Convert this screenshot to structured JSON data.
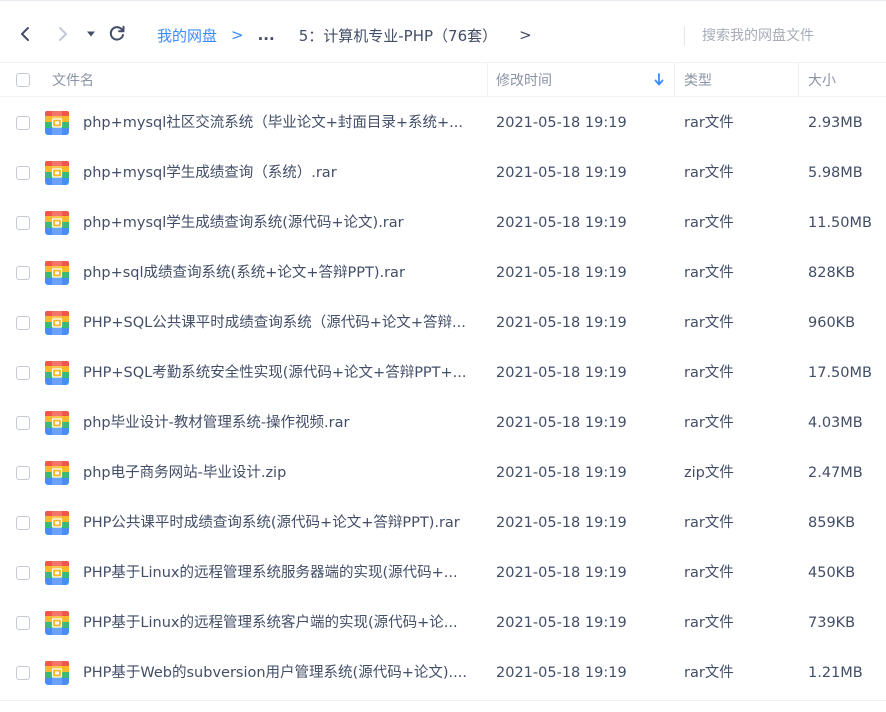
{
  "toolbar": {
    "breadcrumb_root": "我的网盘",
    "breadcrumb_sep": ">",
    "breadcrumb_ellipsis": "...",
    "breadcrumb_current": "5：计算机专业-PHP（76套）",
    "breadcrumb_next": ">",
    "search_placeholder": "搜索我的网盘文件"
  },
  "icons": {
    "back": "chevron-left-icon",
    "forward": "chevron-right-icon",
    "dropdown": "caret-down-icon",
    "refresh": "refresh-icon",
    "sort": "arrow-down-icon",
    "file": "archive-file-icon"
  },
  "colors": {
    "accent": "#3b8cff",
    "text": "#424e67",
    "muted": "#8a93a6"
  },
  "table": {
    "headers": {
      "name": "文件名",
      "modified": "修改时间",
      "type": "类型",
      "size": "大小"
    },
    "sort_column": "modified",
    "sort_direction": "desc",
    "rows": [
      {
        "name": "php+mysql社区交流系统（毕业论文+封面目录+系统+...",
        "modified": "2021-05-18 19:19",
        "type": "rar文件",
        "size": "2.93MB"
      },
      {
        "name": "php+mysql学生成绩查询（系统）.rar",
        "modified": "2021-05-18 19:19",
        "type": "rar文件",
        "size": "5.98MB"
      },
      {
        "name": "php+mysql学生成绩查询系统(源代码+论文).rar",
        "modified": "2021-05-18 19:19",
        "type": "rar文件",
        "size": "11.50MB"
      },
      {
        "name": "php+sql成绩查询系统(系统+论文+答辩PPT).rar",
        "modified": "2021-05-18 19:19",
        "type": "rar文件",
        "size": "828KB"
      },
      {
        "name": "PHP+SQL公共课平时成绩查询系统（源代码+论文+答辩...",
        "modified": "2021-05-18 19:19",
        "type": "rar文件",
        "size": "960KB"
      },
      {
        "name": "PHP+SQL考勤系统安全性实现(源代码+论文+答辩PPT+...",
        "modified": "2021-05-18 19:19",
        "type": "rar文件",
        "size": "17.50MB"
      },
      {
        "name": "php毕业设计-教材管理系统-操作视频.rar",
        "modified": "2021-05-18 19:19",
        "type": "rar文件",
        "size": "4.03MB"
      },
      {
        "name": "php电子商务网站-毕业设计.zip",
        "modified": "2021-05-18 19:19",
        "type": "zip文件",
        "size": "2.47MB"
      },
      {
        "name": "PHP公共课平时成绩查询系统(源代码+论文+答辩PPT).rar",
        "modified": "2021-05-18 19:19",
        "type": "rar文件",
        "size": "859KB"
      },
      {
        "name": "PHP基于Linux的远程管理系统服务器端的实现(源代码+...",
        "modified": "2021-05-18 19:19",
        "type": "rar文件",
        "size": "450KB"
      },
      {
        "name": "PHP基于Linux的远程管理系统客户端的实现(源代码+论...",
        "modified": "2021-05-18 19:19",
        "type": "rar文件",
        "size": "739KB"
      },
      {
        "name": "PHP基于Web的subversion用户管理系统(源代码+论文)....",
        "modified": "2021-05-18 19:19",
        "type": "rar文件",
        "size": "1.21MB"
      }
    ]
  }
}
